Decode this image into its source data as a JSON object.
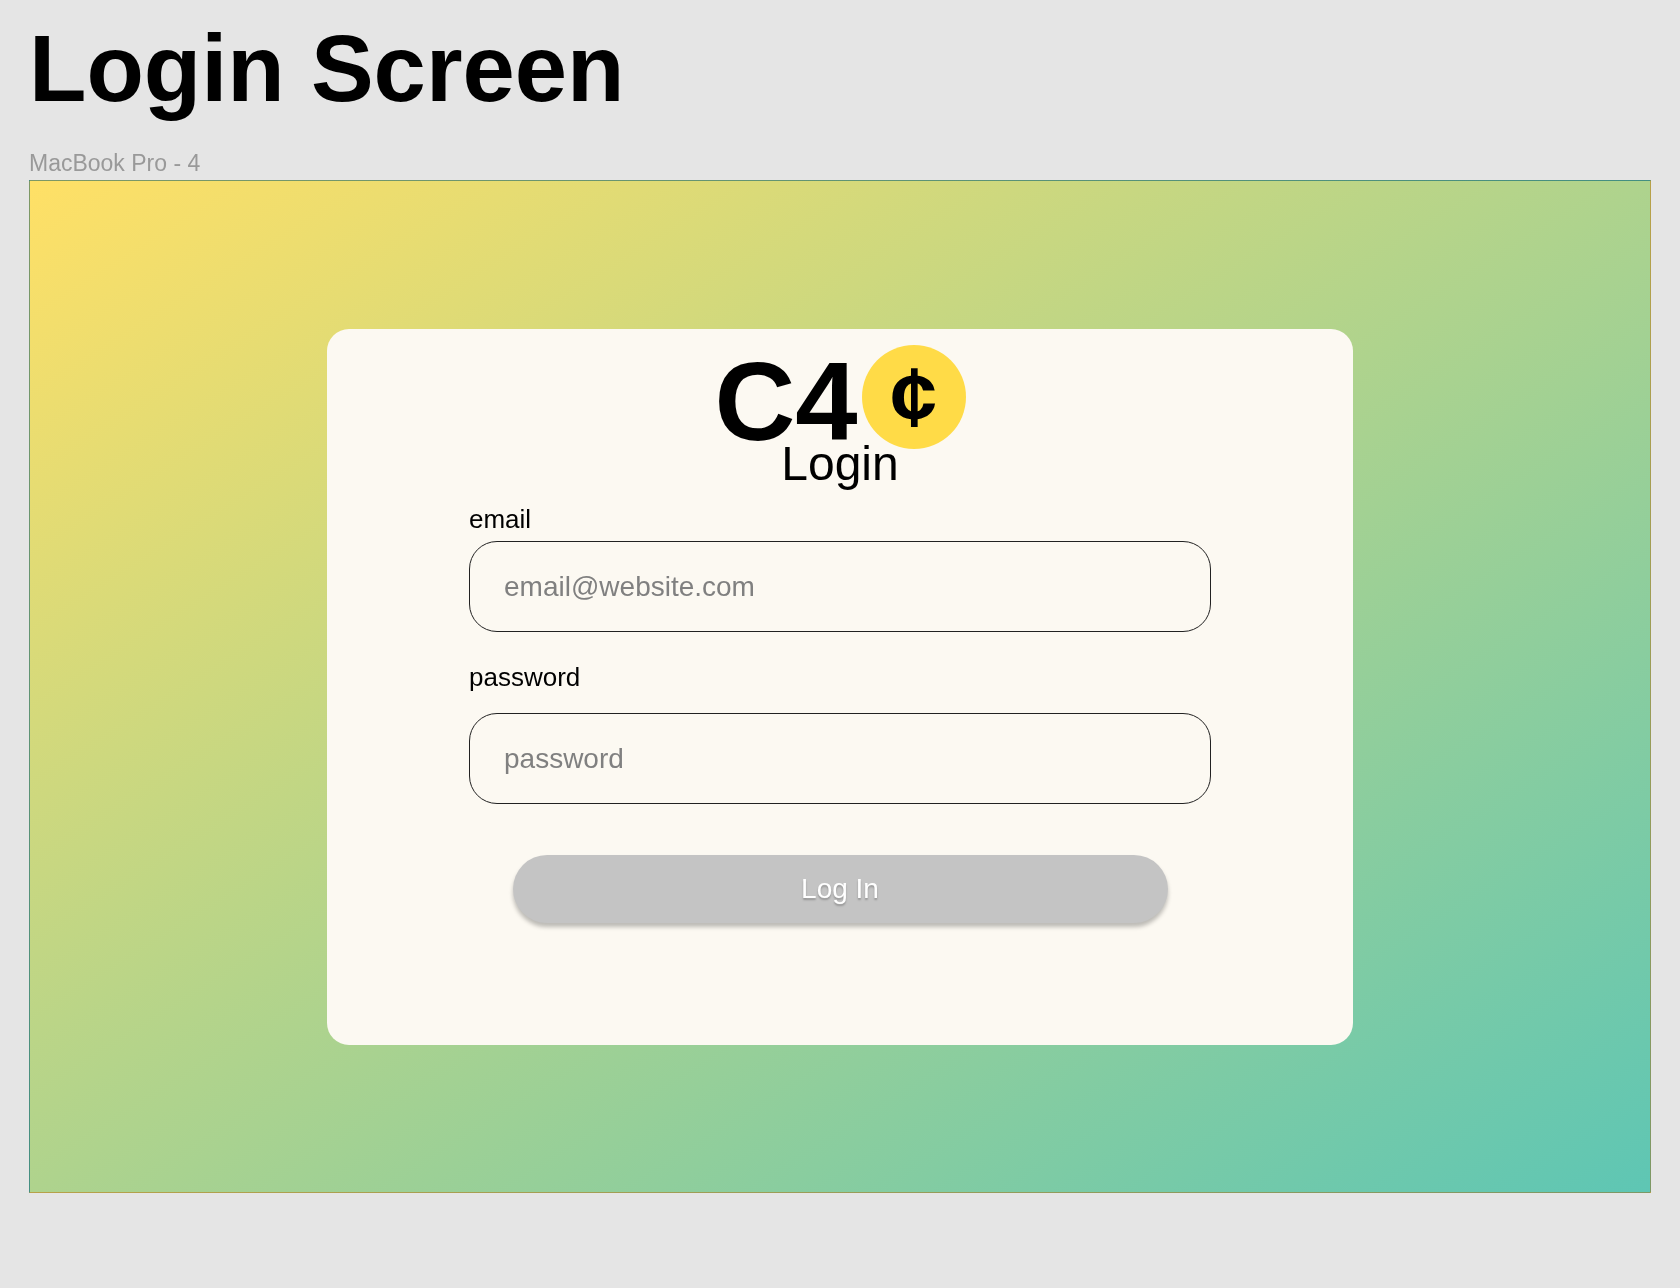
{
  "page": {
    "title": "Login Screen"
  },
  "frame": {
    "label": "MacBook Pro - 4"
  },
  "card": {
    "logo": {
      "text": "C4",
      "coin": "¢"
    },
    "heading": "Login",
    "fields": [
      {
        "label": "email",
        "placeholder": "email@website.com"
      },
      {
        "label": "password",
        "placeholder": "password"
      }
    ],
    "button": {
      "label": "Log In"
    }
  }
}
